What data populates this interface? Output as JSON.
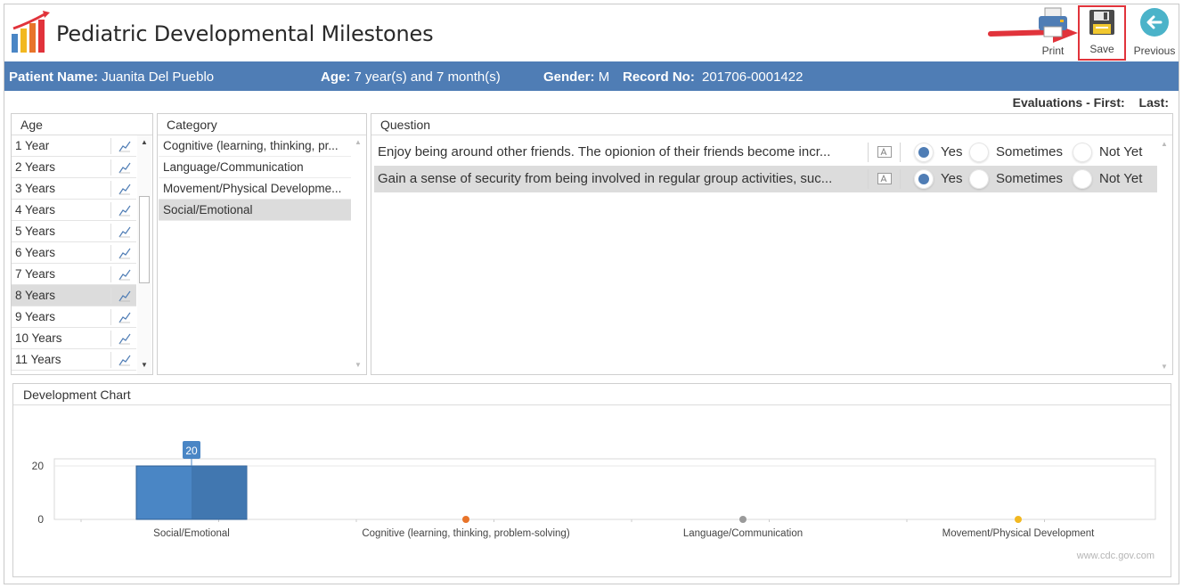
{
  "app": {
    "title": "Pediatric Developmental Milestones"
  },
  "toolbar": {
    "print_label": "Print",
    "save_label": "Save",
    "previous_label": "Previous"
  },
  "patient": {
    "name_label": "Patient Name:",
    "name_value": "Juanita Del Pueblo",
    "age_label": "Age:",
    "age_value": "7 year(s) and 7 month(s)",
    "gender_label": "Gender:",
    "gender_value": "M",
    "record_label": "Record No:",
    "record_value": "201706-0001422"
  },
  "evaluations": {
    "label": "Evaluations - First:",
    "last_label": "Last:"
  },
  "age_panel": {
    "header": "Age",
    "items": [
      {
        "label": "1 Year"
      },
      {
        "label": "2 Years"
      },
      {
        "label": "3 Years"
      },
      {
        "label": "4 Years"
      },
      {
        "label": "5 Years"
      },
      {
        "label": "6 Years"
      },
      {
        "label": "7 Years"
      },
      {
        "label": "8 Years",
        "selected": true
      },
      {
        "label": "9 Years"
      },
      {
        "label": "10 Years"
      },
      {
        "label": "11 Years"
      }
    ]
  },
  "category_panel": {
    "header": "Category",
    "items": [
      {
        "label": "Cognitive (learning, thinking, pr..."
      },
      {
        "label": "Language/Communication"
      },
      {
        "label": "Movement/Physical Developme..."
      },
      {
        "label": "Social/Emotional",
        "selected": true
      }
    ]
  },
  "question_panel": {
    "header": "Question",
    "option_labels": [
      "Yes",
      "Sometimes",
      "Not Yet"
    ],
    "rows": [
      {
        "text": "Enjoy being around other friends. The opionion of their friends become incr...",
        "answer": "Yes"
      },
      {
        "text": "Gain a sense of security from being involved in regular group activities, suc...",
        "answer": "Yes",
        "selected": true
      }
    ]
  },
  "chart_panel": {
    "header": "Development Chart",
    "watermark": "www.cdc.gov.com"
  },
  "chart_data": {
    "type": "bar",
    "categories": [
      "Social/Emotional",
      "Cognitive (learning, thinking, problem-solving)",
      "Language/Communication",
      "Movement/Physical Development"
    ],
    "values": [
      20,
      0,
      0,
      0
    ],
    "data_labels": [
      "20",
      "",
      "",
      ""
    ],
    "yticks": [
      "0",
      "20"
    ],
    "ylim": [
      0,
      20
    ],
    "marker_colors": [
      "#5b8fc7",
      "#e8742a",
      "#9a9a9a",
      "#f2b821"
    ],
    "bar_color": "#4a86c5",
    "title": "",
    "xlabel": "",
    "ylabel": ""
  }
}
